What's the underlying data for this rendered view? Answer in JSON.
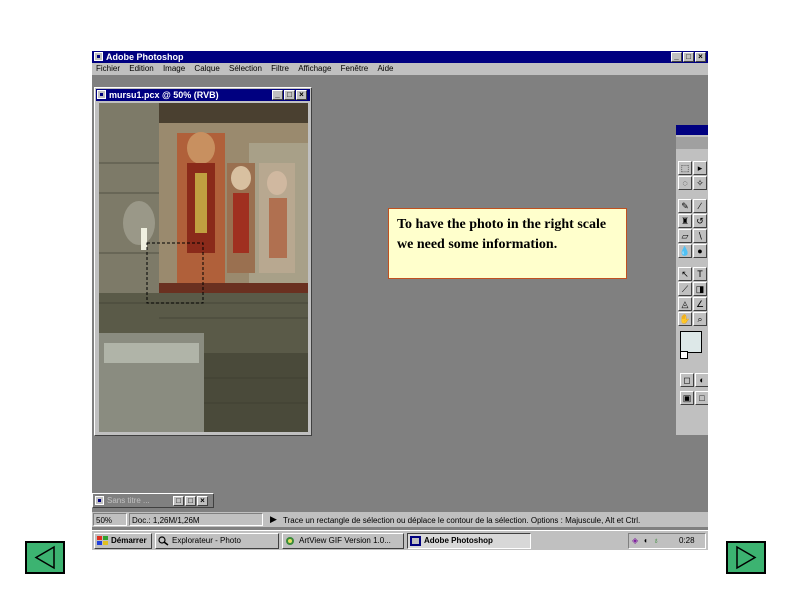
{
  "app": {
    "title": "Adobe Photoshop",
    "menus": [
      "Fichier",
      "Edition",
      "Image",
      "Calque",
      "Sélection",
      "Filtre",
      "Affichage",
      "Fenêtre",
      "Aide"
    ],
    "window_buttons": [
      "_",
      "□",
      "×"
    ]
  },
  "document": {
    "title": "mursu1.pcx @ 50% (RVB)"
  },
  "callout": {
    "text": "To have the photo in the right scale we need some information."
  },
  "minimized_window": {
    "title": "Sans titre ..."
  },
  "statusbar": {
    "zoom": "50%",
    "doc_size": "Doc.: 1,26M/1,26M",
    "hint": "Trace un rectangle de sélection ou déplace le contour de la sélection. Options : Majuscule, Alt et Ctrl."
  },
  "taskbar": {
    "start": "Démarrer",
    "tasks": [
      {
        "label": "Explorateur - Photo",
        "active": false
      },
      {
        "label": "ArtView GIF Version 1.0...",
        "active": false
      },
      {
        "label": "Adobe Photoshop",
        "active": true
      }
    ],
    "clock": "0:28"
  },
  "colors": {
    "titlebar": "#000080",
    "workspace": "#808080",
    "callout_bg": "#ffffcc",
    "callout_border": "#c05020",
    "nav_button": "#3cb371"
  },
  "nav": {
    "prev_icon": "triangle-left-icon",
    "next_icon": "triangle-right-icon"
  }
}
